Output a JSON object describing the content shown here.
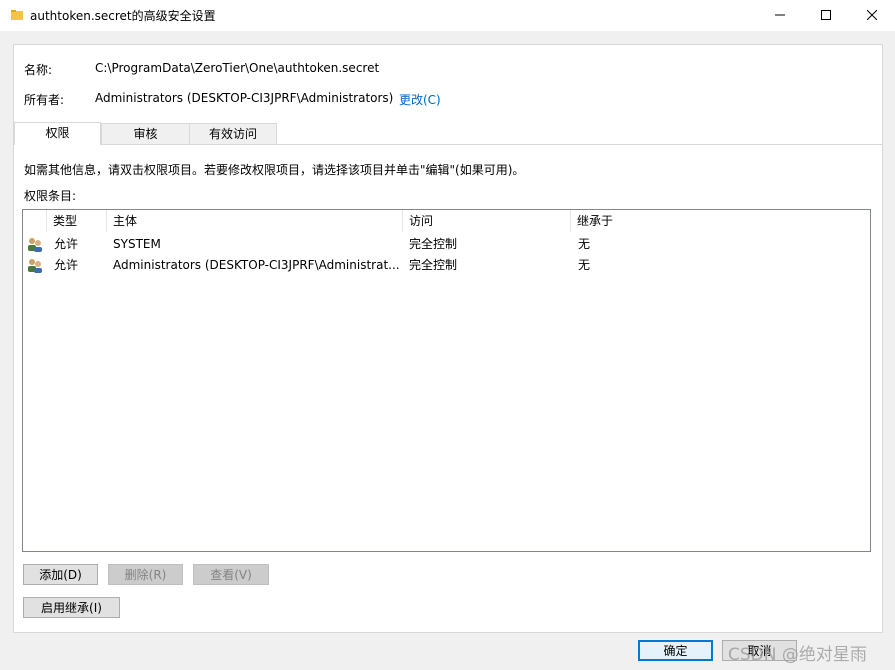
{
  "window": {
    "title": "authtoken.secret的高级安全设置",
    "controls": [
      "minimize-icon",
      "maximize-icon",
      "close-icon"
    ]
  },
  "info": {
    "name_label": "名称:",
    "name_value": "C:\\ProgramData\\ZeroTier\\One\\authtoken.secret",
    "owner_label": "所有者:",
    "owner_value": "Administrators (DESKTOP-CI3JPRF\\Administrators)",
    "owner_change": "更改(C)"
  },
  "tabs": [
    {
      "label": "权限",
      "active": true
    },
    {
      "label": "审核",
      "active": false
    },
    {
      "label": "有效访问",
      "active": false
    }
  ],
  "instructions": "如需其他信息，请双击权限项目。若要修改权限项目，请选择该项目并单击\"编辑\"(如果可用)。",
  "entries_label": "权限条目:",
  "table": {
    "headers": [
      "类型",
      "主体",
      "访问",
      "继承于"
    ],
    "rows": [
      {
        "type": "允许",
        "principal": "SYSTEM",
        "access": "完全控制",
        "inherited": "无",
        "icon": "users-icon"
      },
      {
        "type": "允许",
        "principal": "Administrators (DESKTOP-CI3JPRF\\Administrat...",
        "access": "完全控制",
        "inherited": "无",
        "icon": "users-icon"
      }
    ]
  },
  "buttons": {
    "add": "添加(D)",
    "remove": "删除(R)",
    "view": "查看(V)",
    "enable_inheritance": "启用继承(I)",
    "ok": "确定",
    "cancel": "取消"
  },
  "watermark": "CSDN @绝对星雨"
}
